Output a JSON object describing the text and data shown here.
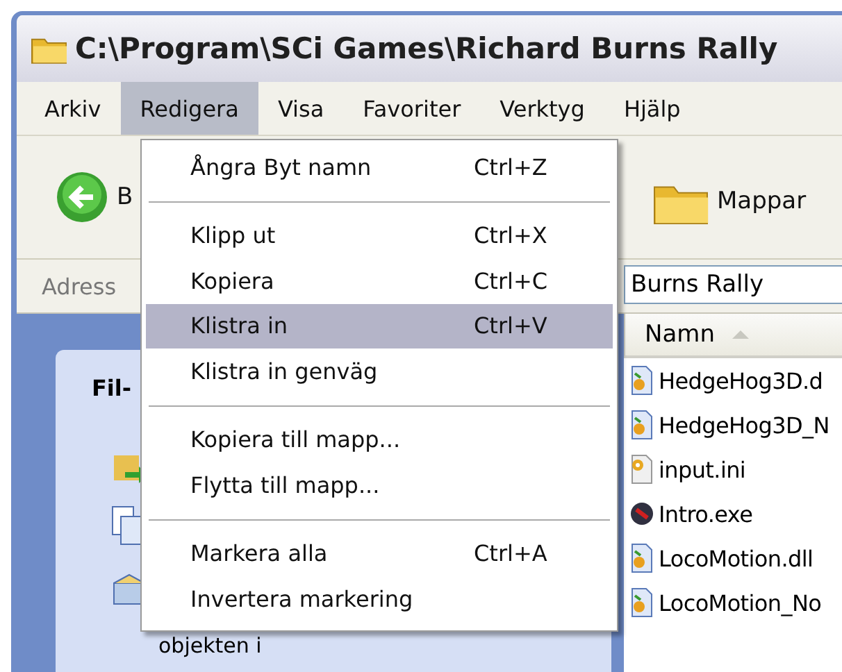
{
  "window": {
    "title": "C:\\Program\\SCi Games\\Richard Burns Rally"
  },
  "menubar": [
    {
      "label": "Arkiv",
      "selected": false
    },
    {
      "label": "Redigera",
      "selected": true
    },
    {
      "label": "Visa",
      "selected": false
    },
    {
      "label": "Favoriter",
      "selected": false
    },
    {
      "label": "Verktyg",
      "selected": false
    },
    {
      "label": "Hjälp",
      "selected": false
    }
  ],
  "toolbar": {
    "back_label": "B",
    "folders_label": "Mappar"
  },
  "address": {
    "label": "Adress",
    "value": "Burns Rally"
  },
  "task_pane": {
    "heading": "Fil-",
    "text": "objekten i"
  },
  "file_list": {
    "column": "Namn",
    "files": [
      {
        "name": "HedgeHog3D.d",
        "kind": "library"
      },
      {
        "name": "HedgeHog3D_N",
        "kind": "library"
      },
      {
        "name": "input.ini",
        "kind": "settings"
      },
      {
        "name": "Intro.exe",
        "kind": "program"
      },
      {
        "name": "LocoMotion.dll",
        "kind": "library"
      },
      {
        "name": "LocoMotion_No",
        "kind": "library"
      }
    ]
  },
  "edit_menu": [
    {
      "kind": "item",
      "label": "Ångra Byt namn",
      "shortcut": "Ctrl+Z",
      "selected": false
    },
    {
      "kind": "separator"
    },
    {
      "kind": "item",
      "label": "Klipp ut",
      "shortcut": "Ctrl+X",
      "selected": false
    },
    {
      "kind": "item",
      "label": "Kopiera",
      "shortcut": "Ctrl+C",
      "selected": false
    },
    {
      "kind": "item",
      "label": "Klistra in",
      "shortcut": "Ctrl+V",
      "selected": true
    },
    {
      "kind": "item",
      "label": "Klistra in genväg",
      "selected": false
    },
    {
      "kind": "separator"
    },
    {
      "kind": "item",
      "label": "Kopiera till mapp...",
      "selected": false
    },
    {
      "kind": "item",
      "label": "Flytta till mapp...",
      "selected": false
    },
    {
      "kind": "separator"
    },
    {
      "kind": "item",
      "label": "Markera alla",
      "shortcut": "Ctrl+A",
      "selected": false
    },
    {
      "kind": "item",
      "label": "Invertera markering",
      "selected": false
    }
  ]
}
